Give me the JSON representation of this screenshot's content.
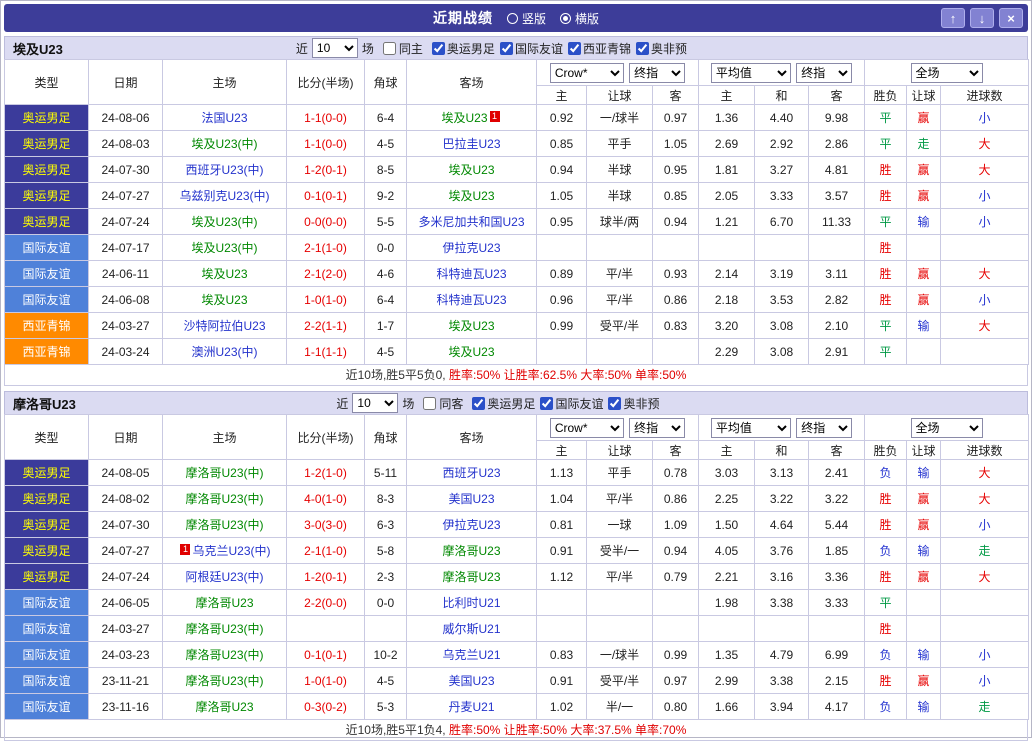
{
  "colors": {
    "accent": "#3d3d99",
    "olympic_bg": "#3b3b9b",
    "olympic_text": "#ffff00",
    "friendly_bg": "#4f81d9",
    "friendly_text": "#ffffff",
    "westasia_bg": "#ff8a00",
    "westasia_text": "#ffffff",
    "team_green": "#008800",
    "opponent_blue": "#2433cc",
    "win_red": "#e60000",
    "draw_green": "#009944",
    "lose_blue": "#2433d0",
    "score_red": "#e60000"
  },
  "titlebar": {
    "title": "近期战绩",
    "vertical_label": "竖版",
    "horizontal_label": "横版",
    "selected_layout": "横版",
    "up_icon": "↑",
    "down_icon": "↓",
    "close_icon": "×"
  },
  "controls_labels": {
    "near": "近",
    "games": "场"
  },
  "table_header": {
    "type": "类型",
    "date": "日期",
    "home": "主场",
    "score": "比分(半场)",
    "corner": "角球",
    "away": "客场",
    "odds_source": "Crow*",
    "odds_index": "终指",
    "avg_source": "平均值",
    "avg_index": "终指",
    "fulltime": "全场",
    "odds_home": "主",
    "odds_handicap": "让球",
    "odds_away": "客",
    "avg_home": "主",
    "avg_draw": "和",
    "avg_away": "客",
    "result": "胜负",
    "handicap_result": "让球",
    "goals": "进球数"
  },
  "sections": [
    {
      "team": "埃及U23",
      "recent_count": "10",
      "same_label": "同主",
      "same_checked": false,
      "filters": [
        {
          "label": "奥运男足",
          "checked": true
        },
        {
          "label": "国际友谊",
          "checked": true
        },
        {
          "label": "西亚青锦",
          "checked": true
        },
        {
          "label": "奥非预",
          "checked": true
        }
      ],
      "rows": [
        {
          "type": "奥运男足",
          "type_style": "olympic",
          "date": "24-08-06",
          "home": "法国U23",
          "home_style": "opponent",
          "home_badge": "",
          "score": "1-1(0-0)",
          "corner": "6-4",
          "away": "埃及U23",
          "away_style": "team",
          "away_badge": "1",
          "odds": [
            "0.92",
            "一/球半",
            "0.97"
          ],
          "avg": [
            "1.36",
            "4.40",
            "9.98"
          ],
          "result": "平",
          "result_style": "draw",
          "handicap_result": "赢",
          "handicap_style": "win",
          "goals": "小",
          "goals_style": "under"
        },
        {
          "type": "奥运男足",
          "type_style": "olympic",
          "date": "24-08-03",
          "home": "埃及U23(中)",
          "home_style": "team",
          "home_badge": "",
          "score": "1-1(0-0)",
          "corner": "4-5",
          "away": "巴拉圭U23",
          "away_style": "opponent",
          "away_badge": "",
          "odds": [
            "0.85",
            "平手",
            "1.05"
          ],
          "avg": [
            "2.69",
            "2.92",
            "2.86"
          ],
          "result": "平",
          "result_style": "draw",
          "handicap_result": "走",
          "handicap_style": "walk",
          "goals": "大",
          "goals_style": "over"
        },
        {
          "type": "奥运男足",
          "type_style": "olympic",
          "date": "24-07-30",
          "home": "西班牙U23(中)",
          "home_style": "opponent",
          "home_badge": "",
          "score": "1-2(0-1)",
          "corner": "8-5",
          "away": "埃及U23",
          "away_style": "team",
          "away_badge": "",
          "odds": [
            "0.94",
            "半球",
            "0.95"
          ],
          "avg": [
            "1.81",
            "3.27",
            "4.81"
          ],
          "result": "胜",
          "result_style": "win",
          "handicap_result": "赢",
          "handicap_style": "win",
          "goals": "大",
          "goals_style": "over"
        },
        {
          "type": "奥运男足",
          "type_style": "olympic",
          "date": "24-07-27",
          "home": "乌兹别克U23(中)",
          "home_style": "opponent",
          "home_badge": "",
          "score": "0-1(0-1)",
          "corner": "9-2",
          "away": "埃及U23",
          "away_style": "team",
          "away_badge": "",
          "odds": [
            "1.05",
            "半球",
            "0.85"
          ],
          "avg": [
            "2.05",
            "3.33",
            "3.57"
          ],
          "result": "胜",
          "result_style": "win",
          "handicap_result": "赢",
          "handicap_style": "win",
          "goals": "小",
          "goals_style": "under"
        },
        {
          "type": "奥运男足",
          "type_style": "olympic",
          "date": "24-07-24",
          "home": "埃及U23(中)",
          "home_style": "team",
          "home_badge": "",
          "score": "0-0(0-0)",
          "corner": "5-5",
          "away": "多米尼加共和国U23",
          "away_style": "opponent",
          "away_badge": "",
          "odds": [
            "0.95",
            "球半/两",
            "0.94"
          ],
          "avg": [
            "1.21",
            "6.70",
            "11.33"
          ],
          "result": "平",
          "result_style": "draw",
          "handicap_result": "输",
          "handicap_style": "lose",
          "goals": "小",
          "goals_style": "under"
        },
        {
          "type": "国际友谊",
          "type_style": "friendly",
          "date": "24-07-17",
          "home": "埃及U23(中)",
          "home_style": "team",
          "home_badge": "",
          "score": "2-1(1-0)",
          "corner": "0-0",
          "away": "伊拉克U23",
          "away_style": "opponent",
          "away_badge": "",
          "odds": [
            "",
            "",
            ""
          ],
          "avg": [
            "",
            "",
            ""
          ],
          "result": "胜",
          "result_style": "win",
          "handicap_result": "",
          "handicap_style": "none",
          "goals": "",
          "goals_style": "none"
        },
        {
          "type": "国际友谊",
          "type_style": "friendly",
          "date": "24-06-11",
          "home": "埃及U23",
          "home_style": "team",
          "home_badge": "",
          "score": "2-1(2-0)",
          "corner": "4-6",
          "away": "科特迪瓦U23",
          "away_style": "opponent",
          "away_badge": "",
          "odds": [
            "0.89",
            "平/半",
            "0.93"
          ],
          "avg": [
            "2.14",
            "3.19",
            "3.11"
          ],
          "result": "胜",
          "result_style": "win",
          "handicap_result": "赢",
          "handicap_style": "win",
          "goals": "大",
          "goals_style": "over"
        },
        {
          "type": "国际友谊",
          "type_style": "friendly",
          "date": "24-06-08",
          "home": "埃及U23",
          "home_style": "team",
          "home_badge": "",
          "score": "1-0(1-0)",
          "corner": "6-4",
          "away": "科特迪瓦U23",
          "away_style": "opponent",
          "away_badge": "",
          "odds": [
            "0.96",
            "平/半",
            "0.86"
          ],
          "avg": [
            "2.18",
            "3.53",
            "2.82"
          ],
          "result": "胜",
          "result_style": "win",
          "handicap_result": "赢",
          "handicap_style": "win",
          "goals": "小",
          "goals_style": "under"
        },
        {
          "type": "西亚青锦",
          "type_style": "westasia",
          "date": "24-03-27",
          "home": "沙特阿拉伯U23",
          "home_style": "opponent",
          "home_badge": "",
          "score": "2-2(1-1)",
          "corner": "1-7",
          "away": "埃及U23",
          "away_style": "team",
          "away_badge": "",
          "odds": [
            "0.99",
            "受平/半",
            "0.83"
          ],
          "avg": [
            "3.20",
            "3.08",
            "2.10"
          ],
          "result": "平",
          "result_style": "draw",
          "handicap_result": "输",
          "handicap_style": "lose",
          "goals": "大",
          "goals_style": "over"
        },
        {
          "type": "西亚青锦",
          "type_style": "westasia",
          "date": "24-03-24",
          "home": "澳洲U23(中)",
          "home_style": "opponent",
          "home_badge": "",
          "score": "1-1(1-1)",
          "corner": "4-5",
          "away": "埃及U23",
          "away_style": "team",
          "away_badge": "",
          "odds": [
            "",
            "",
            ""
          ],
          "avg": [
            "2.29",
            "3.08",
            "2.91"
          ],
          "result": "平",
          "result_style": "draw",
          "handicap_result": "",
          "handicap_style": "none",
          "goals": "",
          "goals_style": "none"
        }
      ],
      "summary_prefix": "近10场,胜5平5负0,",
      "summary_stats": "胜率:50% 让胜率:62.5% 大率:50% 单率:50%"
    },
    {
      "team": "摩洛哥U23",
      "recent_count": "10",
      "same_label": "同客",
      "same_checked": false,
      "filters": [
        {
          "label": "奥运男足",
          "checked": true
        },
        {
          "label": "国际友谊",
          "checked": true
        },
        {
          "label": "奥非预",
          "checked": true
        }
      ],
      "rows": [
        {
          "type": "奥运男足",
          "type_style": "olympic",
          "date": "24-08-05",
          "home": "摩洛哥U23(中)",
          "home_style": "team",
          "home_badge": "",
          "score": "1-2(1-0)",
          "corner": "5-11",
          "away": "西班牙U23",
          "away_style": "opponent",
          "away_badge": "",
          "odds": [
            "1.13",
            "平手",
            "0.78"
          ],
          "avg": [
            "3.03",
            "3.13",
            "2.41"
          ],
          "result": "负",
          "result_style": "lose",
          "handicap_result": "输",
          "handicap_style": "lose",
          "goals": "大",
          "goals_style": "over"
        },
        {
          "type": "奥运男足",
          "type_style": "olympic",
          "date": "24-08-02",
          "home": "摩洛哥U23(中)",
          "home_style": "team",
          "home_badge": "",
          "score": "4-0(1-0)",
          "corner": "8-3",
          "away": "美国U23",
          "away_style": "opponent",
          "away_badge": "",
          "odds": [
            "1.04",
            "平/半",
            "0.86"
          ],
          "avg": [
            "2.25",
            "3.22",
            "3.22"
          ],
          "result": "胜",
          "result_style": "win",
          "handicap_result": "赢",
          "handicap_style": "win",
          "goals": "大",
          "goals_style": "over"
        },
        {
          "type": "奥运男足",
          "type_style": "olympic",
          "date": "24-07-30",
          "home": "摩洛哥U23(中)",
          "home_style": "team",
          "home_badge": "",
          "score": "3-0(3-0)",
          "corner": "6-3",
          "away": "伊拉克U23",
          "away_style": "opponent",
          "away_badge": "",
          "odds": [
            "0.81",
            "一球",
            "1.09"
          ],
          "avg": [
            "1.50",
            "4.64",
            "5.44"
          ],
          "result": "胜",
          "result_style": "win",
          "handicap_result": "赢",
          "handicap_style": "win",
          "goals": "小",
          "goals_style": "under"
        },
        {
          "type": "奥运男足",
          "type_style": "olympic",
          "date": "24-07-27",
          "home": "乌克兰U23(中)",
          "home_style": "opponent",
          "home_badge": "1",
          "score": "2-1(1-0)",
          "corner": "5-8",
          "away": "摩洛哥U23",
          "away_style": "team",
          "away_badge": "",
          "odds": [
            "0.91",
            "受半/一",
            "0.94"
          ],
          "avg": [
            "4.05",
            "3.76",
            "1.85"
          ],
          "result": "负",
          "result_style": "lose",
          "handicap_result": "输",
          "handicap_style": "lose",
          "goals": "走",
          "goals_style": "walk"
        },
        {
          "type": "奥运男足",
          "type_style": "olympic",
          "date": "24-07-24",
          "home": "阿根廷U23(中)",
          "home_style": "opponent",
          "home_badge": "",
          "score": "1-2(0-1)",
          "corner": "2-3",
          "away": "摩洛哥U23",
          "away_style": "team",
          "away_badge": "",
          "odds": [
            "1.12",
            "平/半",
            "0.79"
          ],
          "avg": [
            "2.21",
            "3.16",
            "3.36"
          ],
          "result": "胜",
          "result_style": "win",
          "handicap_result": "赢",
          "handicap_style": "win",
          "goals": "大",
          "goals_style": "over"
        },
        {
          "type": "国际友谊",
          "type_style": "friendly",
          "date": "24-06-05",
          "home": "摩洛哥U23",
          "home_style": "team",
          "home_badge": "",
          "score": "2-2(0-0)",
          "corner": "0-0",
          "away": "比利时U21",
          "away_style": "opponent",
          "away_badge": "",
          "odds": [
            "",
            "",
            ""
          ],
          "avg": [
            "1.98",
            "3.38",
            "3.33"
          ],
          "result": "平",
          "result_style": "draw",
          "handicap_result": "",
          "handicap_style": "none",
          "goals": "",
          "goals_style": "none"
        },
        {
          "type": "国际友谊",
          "type_style": "friendly",
          "date": "24-03-27",
          "home": "摩洛哥U23(中)",
          "home_style": "team",
          "home_badge": "",
          "score": "",
          "corner": "",
          "away": "威尔斯U21",
          "away_style": "opponent",
          "away_badge": "",
          "odds": [
            "",
            "",
            ""
          ],
          "avg": [
            "",
            "",
            ""
          ],
          "result": "胜",
          "result_style": "win",
          "handicap_result": "",
          "handicap_style": "none",
          "goals": "",
          "goals_style": "none"
        },
        {
          "type": "国际友谊",
          "type_style": "friendly",
          "date": "24-03-23",
          "home": "摩洛哥U23(中)",
          "home_style": "team",
          "home_badge": "",
          "score": "0-1(0-1)",
          "corner": "10-2",
          "away": "乌克兰U21",
          "away_style": "opponent",
          "away_badge": "",
          "odds": [
            "0.83",
            "一/球半",
            "0.99"
          ],
          "avg": [
            "1.35",
            "4.79",
            "6.99"
          ],
          "result": "负",
          "result_style": "lose",
          "handicap_result": "输",
          "handicap_style": "lose",
          "goals": "小",
          "goals_style": "under"
        },
        {
          "type": "国际友谊",
          "type_style": "friendly",
          "date": "23-11-21",
          "home": "摩洛哥U23(中)",
          "home_style": "team",
          "home_badge": "",
          "score": "1-0(1-0)",
          "corner": "4-5",
          "away": "美国U23",
          "away_style": "opponent",
          "away_badge": "",
          "odds": [
            "0.91",
            "受平/半",
            "0.97"
          ],
          "avg": [
            "2.99",
            "3.38",
            "2.15"
          ],
          "result": "胜",
          "result_style": "win",
          "handicap_result": "赢",
          "handicap_style": "win",
          "goals": "小",
          "goals_style": "under"
        },
        {
          "type": "国际友谊",
          "type_style": "friendly",
          "date": "23-11-16",
          "home": "摩洛哥U23",
          "home_style": "team",
          "home_badge": "",
          "score": "0-3(0-2)",
          "corner": "5-3",
          "away": "丹麦U21",
          "away_style": "opponent",
          "away_badge": "",
          "odds": [
            "1.02",
            "半/一",
            "0.80"
          ],
          "avg": [
            "1.66",
            "3.94",
            "4.17"
          ],
          "result": "负",
          "result_style": "lose",
          "handicap_result": "输",
          "handicap_style": "lose",
          "goals": "走",
          "goals_style": "walk"
        }
      ],
      "summary_prefix": "近10场,胜5平1负4,",
      "summary_stats": "胜率:50% 让胜率:50% 大率:37.5% 单率:70%"
    }
  ]
}
